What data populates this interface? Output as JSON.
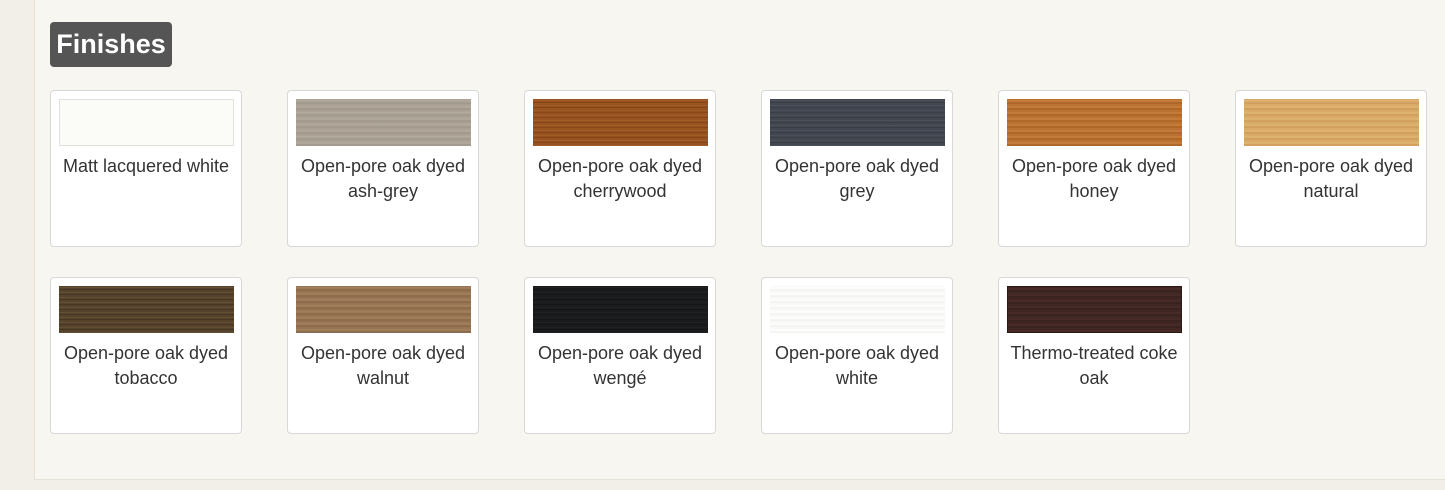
{
  "section": {
    "title": "Finishes"
  },
  "finishes": [
    {
      "label": "Matt lacquered white",
      "swatch": "matt-white",
      "color": "#fbfbf8"
    },
    {
      "label": "Open-pore oak dyed ash-grey",
      "swatch": "ash-grey",
      "color": "#a99f92"
    },
    {
      "label": "Open-pore oak dyed cherrywood",
      "swatch": "cherrywood",
      "color": "#9a5522"
    },
    {
      "label": "Open-pore oak dyed grey",
      "swatch": "grey",
      "color": "#444952"
    },
    {
      "label": "Open-pore oak dyed honey",
      "swatch": "honey",
      "color": "#bb7434"
    },
    {
      "label": "Open-pore oak dyed natural",
      "swatch": "natural",
      "color": "#d9aa69"
    },
    {
      "label": "Open-pore oak dyed tobacco",
      "swatch": "tobacco",
      "color": "#57432c"
    },
    {
      "label": "Open-pore oak dyed walnut",
      "swatch": "walnut",
      "color": "#977556"
    },
    {
      "label": "Open-pore oak dyed wengé",
      "swatch": "wenge",
      "color": "#1b1c1e"
    },
    {
      "label": "Open-pore oak dyed white",
      "swatch": "white",
      "color": "#f8f8f6"
    },
    {
      "label": "Thermo-treated coke oak",
      "swatch": "coke",
      "color": "#412724"
    }
  ]
}
